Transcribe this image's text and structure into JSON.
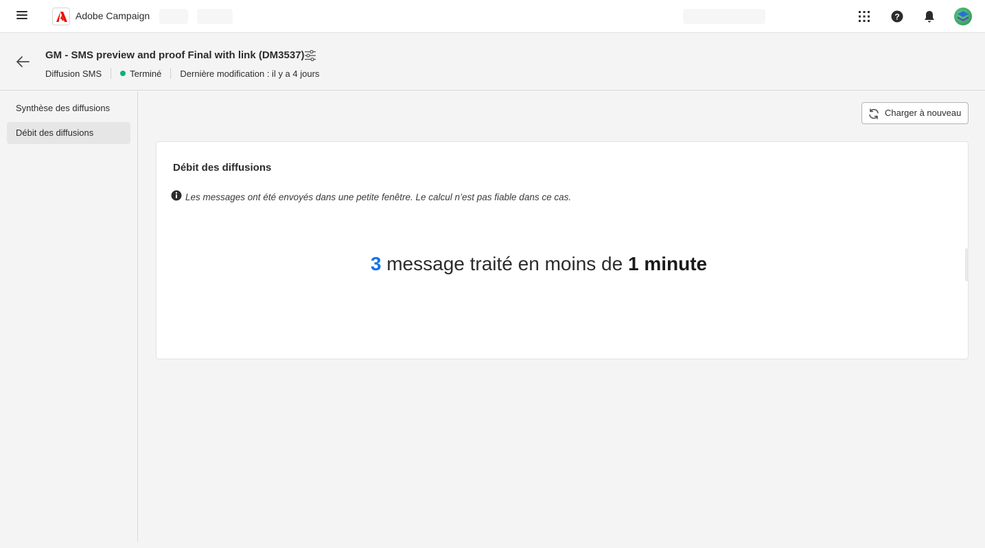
{
  "topbar": {
    "app_name": "Adobe Campaign",
    "icons": [
      "menu-icon",
      "adobe-logo-icon",
      "app-switcher-icon",
      "help-icon",
      "notification-bell-icon",
      "avatar"
    ]
  },
  "header": {
    "title": "GM - SMS preview and proof Final with link (DM3537)",
    "type": "Diffusion SMS",
    "status": "Terminé",
    "status_color": "#12b07a",
    "last_modified": "Dernière modification : il y a 4 jours"
  },
  "sidebar": {
    "items": [
      {
        "label": "Synthèse des diffusions",
        "active": false
      },
      {
        "label": "Débit des diffusions",
        "active": true
      }
    ]
  },
  "toolbar": {
    "reload_label": "Charger à nouveau"
  },
  "card": {
    "title": "Débit des diffusions",
    "info": "Les messages ont été envoyés dans une petite fenêtre. Le calcul n’est pas fiable dans ce cas.",
    "count": "3",
    "text_middle": "message traité en moins de",
    "duration": "1 minute"
  },
  "colors": {
    "accent": "#1473e6",
    "adobe_red": "#eb1000"
  }
}
